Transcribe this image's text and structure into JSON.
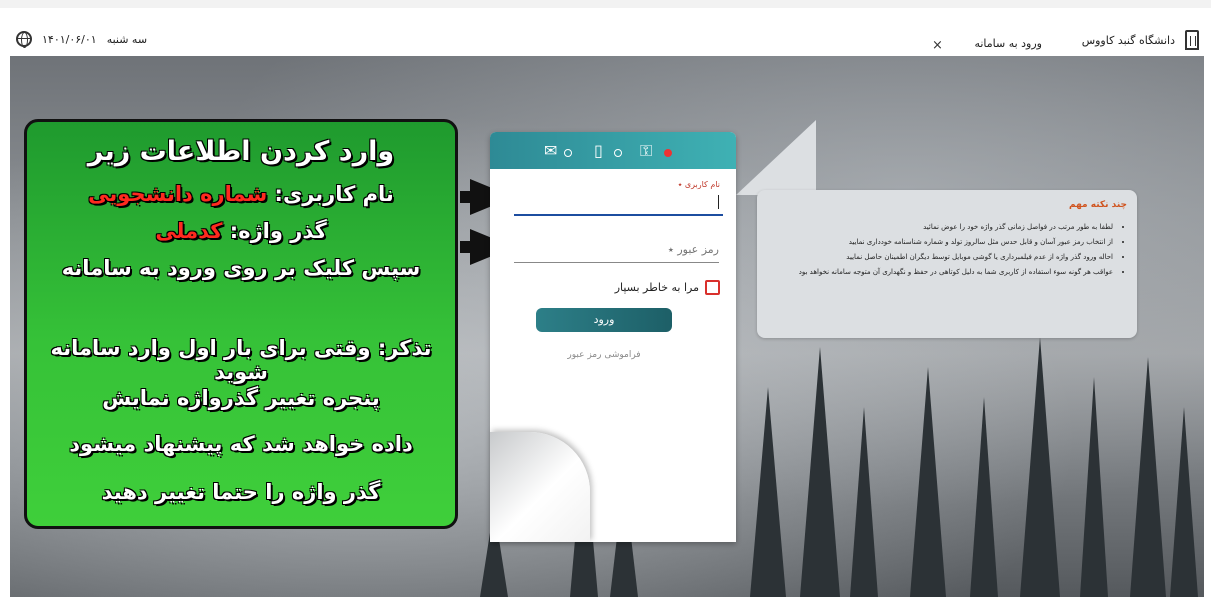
{
  "header": {
    "university_name": "دانشگاه گنبد کاووس",
    "tab_label": "ورود به سامانه",
    "tab_close": "×",
    "weekday": "سه شنبه",
    "date": "۱۴۰۱/۰۶/۰۱"
  },
  "login_card": {
    "username_label": "نام کاربری ٭",
    "password_placeholder": "رمز عبور ٭",
    "remember_label": "مرا به خاطر بسپار",
    "login_button": "ورود",
    "forgot_link": "فراموشی رمز عبور",
    "icons": [
      "email-icon",
      "mobile-icon",
      "key-icon"
    ]
  },
  "tips": {
    "title": "چند نکته مهم",
    "items": [
      "لطفا به طور مرتب در فواصل زمانی گذر واژه خود را عوض نمائید",
      "از انتخاب رمز عبور آسان و قابل حدس مثل سالروز تولد و شماره شناسنامه خودداری نمایید",
      "احاله ورود گذر واژه از عدم فیلمبرداری یا گوشی موبایل توسط دیگران اطمینان حاصل نمایید",
      "عواقب هر گونه سوء استفاده از کاربری شما به دلیل کوتاهی در حفظ و نگهداری آن متوجه سامانه نخواهد بود"
    ]
  },
  "annotation": {
    "line1": "وارد کردن اطلاعات زیر",
    "line2_prefix": "نام کاربری: ",
    "line2_value": "شماره دانشجویی",
    "line3_prefix": "گذر واژه: ",
    "line3_value": "کدملی",
    "line4": "سپس کلیک بر روی ورود به سامانه",
    "line5": "تذکر: وقتی برای بار اول وارد سامانه شوید",
    "line6": "پنجره تغییر گذرواژه نمایش",
    "line7": "داده خواهد شد که پیشنهاد میشود",
    "line8": "گذر واژه را حتما تغییر دهید"
  },
  "colors": {
    "accent": "#1c4da0",
    "annotation_green": "#36c238",
    "highlight_red": "#ff2a1f",
    "login_teal": "#2d7f88"
  }
}
